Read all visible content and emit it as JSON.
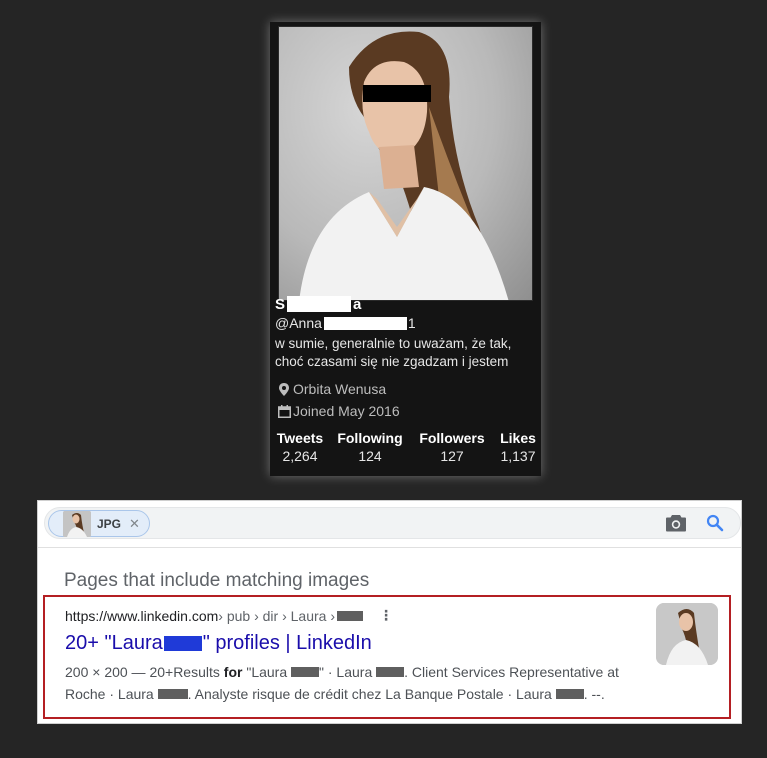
{
  "profile": {
    "name_start": "S",
    "name_end": "a",
    "handle_start": "@Anna",
    "handle_end": "1",
    "bio_line1": "w sumie, generalnie to uważam, że tak,",
    "bio_line2": "choć czasami się nie zgadzam i jestem",
    "location": "Orbita Wenusa",
    "joined": "Joined May 2016",
    "stats": [
      {
        "label": "Tweets",
        "value": "2,264"
      },
      {
        "label": "Following",
        "value": "124"
      },
      {
        "label": "Followers",
        "value": "127"
      },
      {
        "label": "Likes",
        "value": "1,137"
      }
    ],
    "icons": {
      "location": "location-pin-icon",
      "calendar": "calendar-icon"
    }
  },
  "search": {
    "chip_label": "JPG",
    "chip_close": "✕",
    "section_title": "Pages that include matching images",
    "result": {
      "url": "https://www.linkedin.com",
      "breadcrumbs": " › pub › dir › Laura › ",
      "title_start": "20+ \"Laura ",
      "title_end": "\" profiles | LinkedIn",
      "snippet_meta": "200 × 200 — ",
      "snippet_a": "20+Results ",
      "snippet_bold": "for",
      "snippet_b": " \"Laura ",
      "snippet_c": "\" · Laura ",
      "snippet_d": ". Client Services Representative at",
      "snippet_e": "Roche · Laura ",
      "snippet_f": ". Analyste risque de crédit chez La Banque Postale · Laura ",
      "snippet_g": ". --."
    }
  },
  "colors": {
    "page_bg": "#252525",
    "card_bg": "#141414",
    "link_blue": "#1a0dab",
    "highlight_red": "#b41f23",
    "redaction_blue": "#1f3ad8"
  }
}
